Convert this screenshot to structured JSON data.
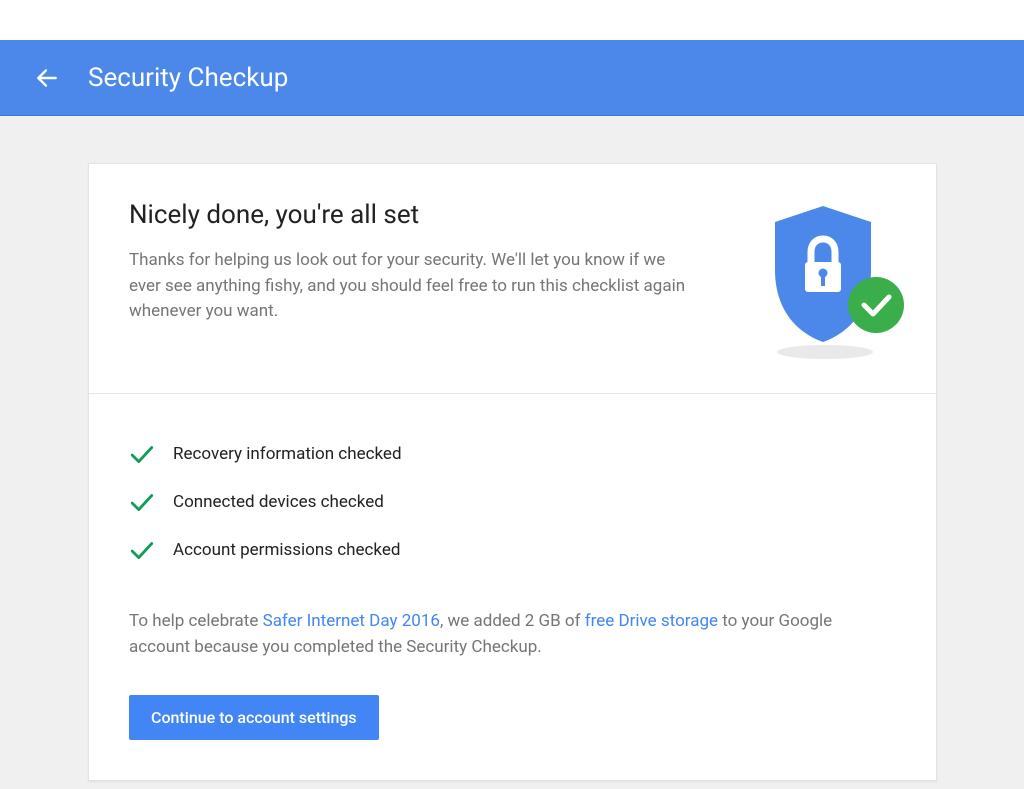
{
  "header": {
    "title": "Security Checkup"
  },
  "card": {
    "heading": "Nicely done, you're all set",
    "subtext": "Thanks for helping us look out for your security. We'll let you know if we ever see anything fishy, and you should feel free to run this checklist again whenever you want."
  },
  "checks": [
    {
      "label": "Recovery information checked"
    },
    {
      "label": "Connected devices checked"
    },
    {
      "label": "Account permissions checked"
    }
  ],
  "footer": {
    "pre": "To help celebrate ",
    "link1": "Safer Internet Day 2016",
    "mid": ", we added 2 GB of ",
    "link2": "free Drive storage",
    "post": " to your Google account because you completed the Security Checkup."
  },
  "cta": {
    "label": "Continue to account settings"
  },
  "colors": {
    "headerBlue": "#4b88ea",
    "buttonBlue": "#4285f4",
    "checkGreen": "#0f9d58",
    "badgeGreen": "#3bae4c",
    "textGray": "#757575"
  }
}
